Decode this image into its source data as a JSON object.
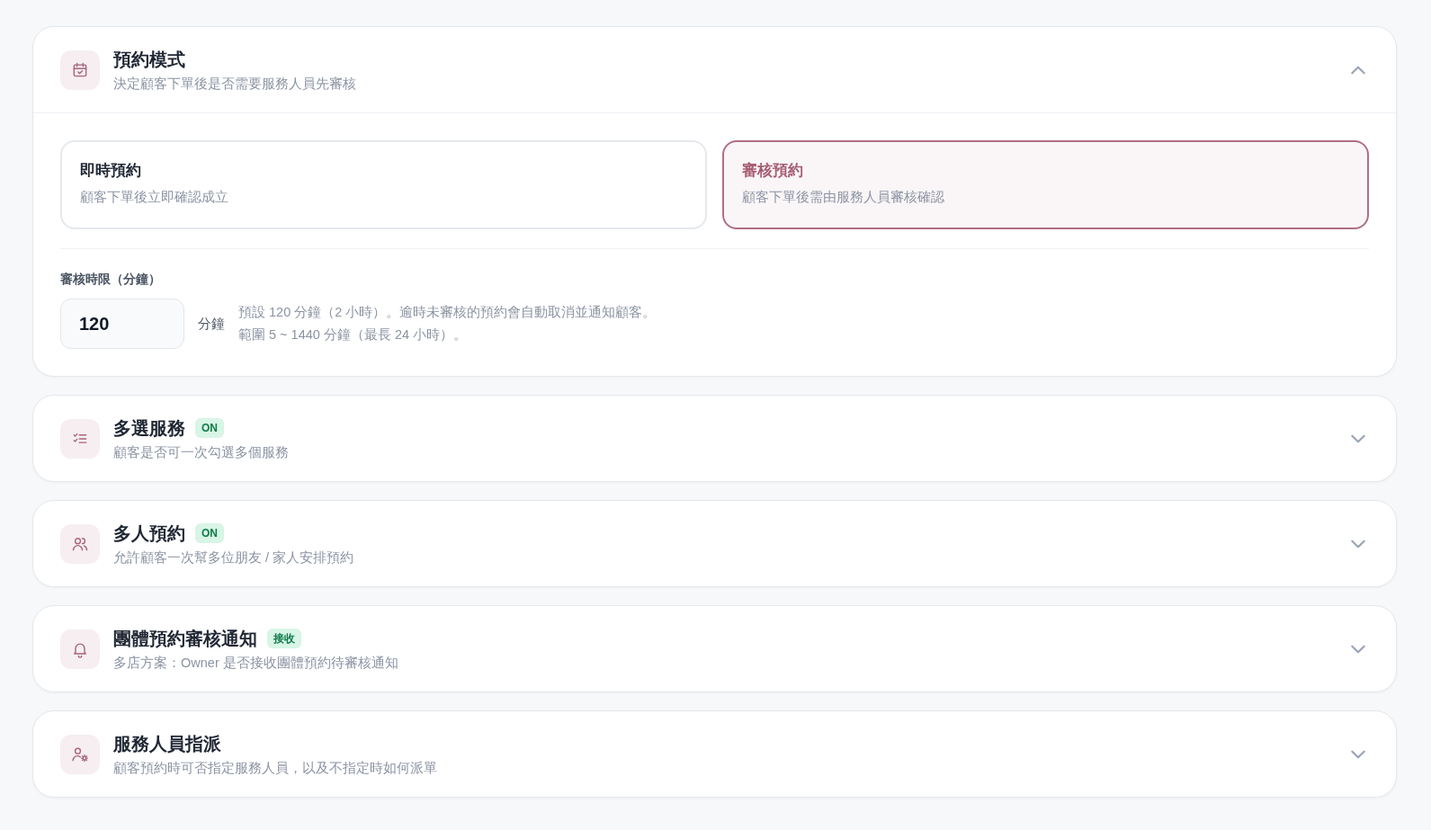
{
  "sections": [
    {
      "title": "預約模式",
      "subtitle": "決定顧客下單後是否需要服務人員先審核",
      "expanded": true,
      "options": [
        {
          "title": "即時預約",
          "description": "顧客下單後立即確認成立",
          "selected": false
        },
        {
          "title": "審核預約",
          "description": "顧客下單後需由服務人員審核確認",
          "selected": true
        }
      ],
      "field": {
        "label": "審核時限（分鐘）",
        "value": "120",
        "unit": "分鐘",
        "help": [
          "預設 120 分鐘（2 小時）。逾時未審核的預約會自動取消並通知顧客。",
          "範圍 5 ~ 1440 分鐘（最長 24 小時）。"
        ]
      }
    },
    {
      "title": "多選服務",
      "badge": "ON",
      "subtitle": "顧客是否可一次勾選多個服務",
      "expanded": false
    },
    {
      "title": "多人預約",
      "badge": "ON",
      "subtitle": "允許顧客一次幫多位朋友 / 家人安排預約",
      "expanded": false
    },
    {
      "title": "團體預約審核通知",
      "badge": "接收",
      "subtitle": "多店方案：Owner 是否接收團體預約待審核通知",
      "expanded": false
    },
    {
      "title": "服務人員指派",
      "subtitle": "顧客預約時可否指定服務人員，以及不指定時如何派單",
      "expanded": false
    }
  ]
}
